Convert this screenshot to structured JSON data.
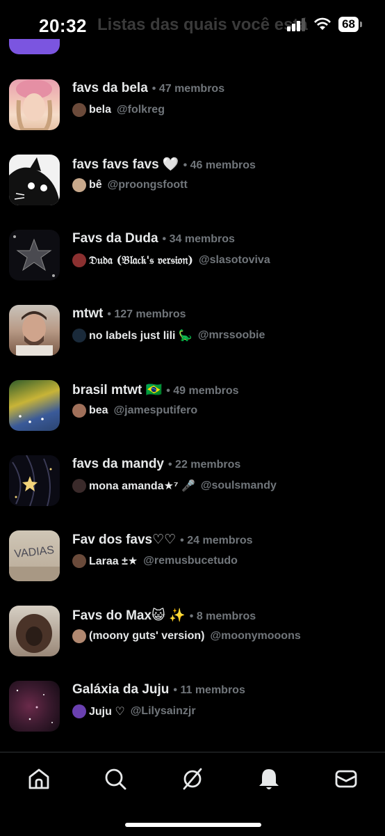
{
  "status_bar": {
    "time": "20:32",
    "battery": "68",
    "behind_title": "Listas das quais você está"
  },
  "lists": [
    {
      "name": "favs da bela",
      "members": "47 membros",
      "owner": "bela",
      "handle": "@folkreg"
    },
    {
      "name": "favs favs favs 🤍",
      "members": "46 membros",
      "owner": "bê",
      "handle": "@proongsfoott"
    },
    {
      "name": "Favs da Duda",
      "members": "34 membros",
      "owner": "𝔇𝔲𝔡𝔞 (𝔅𝔩𝔞𝔠𝔨'𝔰 𝔳𝔢𝔯𝔰𝔦𝔬𝔫)",
      "handle": "@slasotoviva"
    },
    {
      "name": "mtwt",
      "members": "127 membros",
      "owner": "no labels just lili 🦕",
      "handle": "@mrssoobie"
    },
    {
      "name": "brasil mtwt 🇧🇷",
      "members": "49 membros",
      "owner": "bea",
      "handle": "@jamesputifero"
    },
    {
      "name": "favs da mandy",
      "members": "22 membros",
      "owner": "mona amanda★⁷ 🎤",
      "handle": "@soulsmandy"
    },
    {
      "name": "Fav dos favs♡♡",
      "members": "24 membros",
      "owner": "Laraa ±★",
      "handle": "@remusbucetudo"
    },
    {
      "name": "Favs do Max😺 ✨",
      "members": "8 membros",
      "owner": "(moony guts' version)",
      "handle": "@moonymooons"
    },
    {
      "name": "Galáxia da Juju",
      "members": "11 membros",
      "owner": "Juju ♡",
      "handle": "@Lilysainzjr"
    }
  ],
  "tab_bar": [
    "home-icon",
    "search-icon",
    "grok-icon",
    "notifications-icon",
    "messages-icon"
  ],
  "colors": {
    "accent": "#7b55e0",
    "text": "#e7e9ea",
    "secondary": "#71767b",
    "background": "#000000"
  }
}
